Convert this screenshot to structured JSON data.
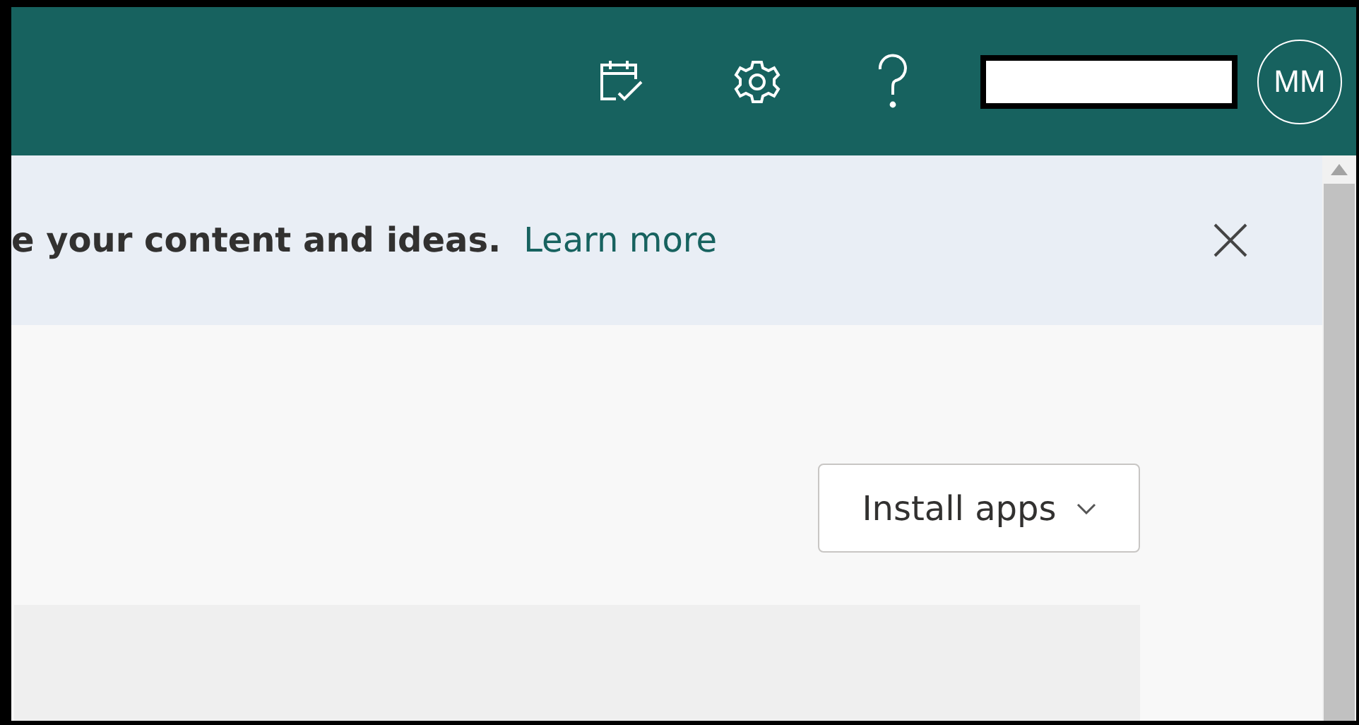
{
  "top_bar": {
    "avatar_initials": "MM"
  },
  "banner": {
    "message": "e your content and ideas.",
    "link": "Learn more"
  },
  "install_button": {
    "label": "Install apps"
  }
}
